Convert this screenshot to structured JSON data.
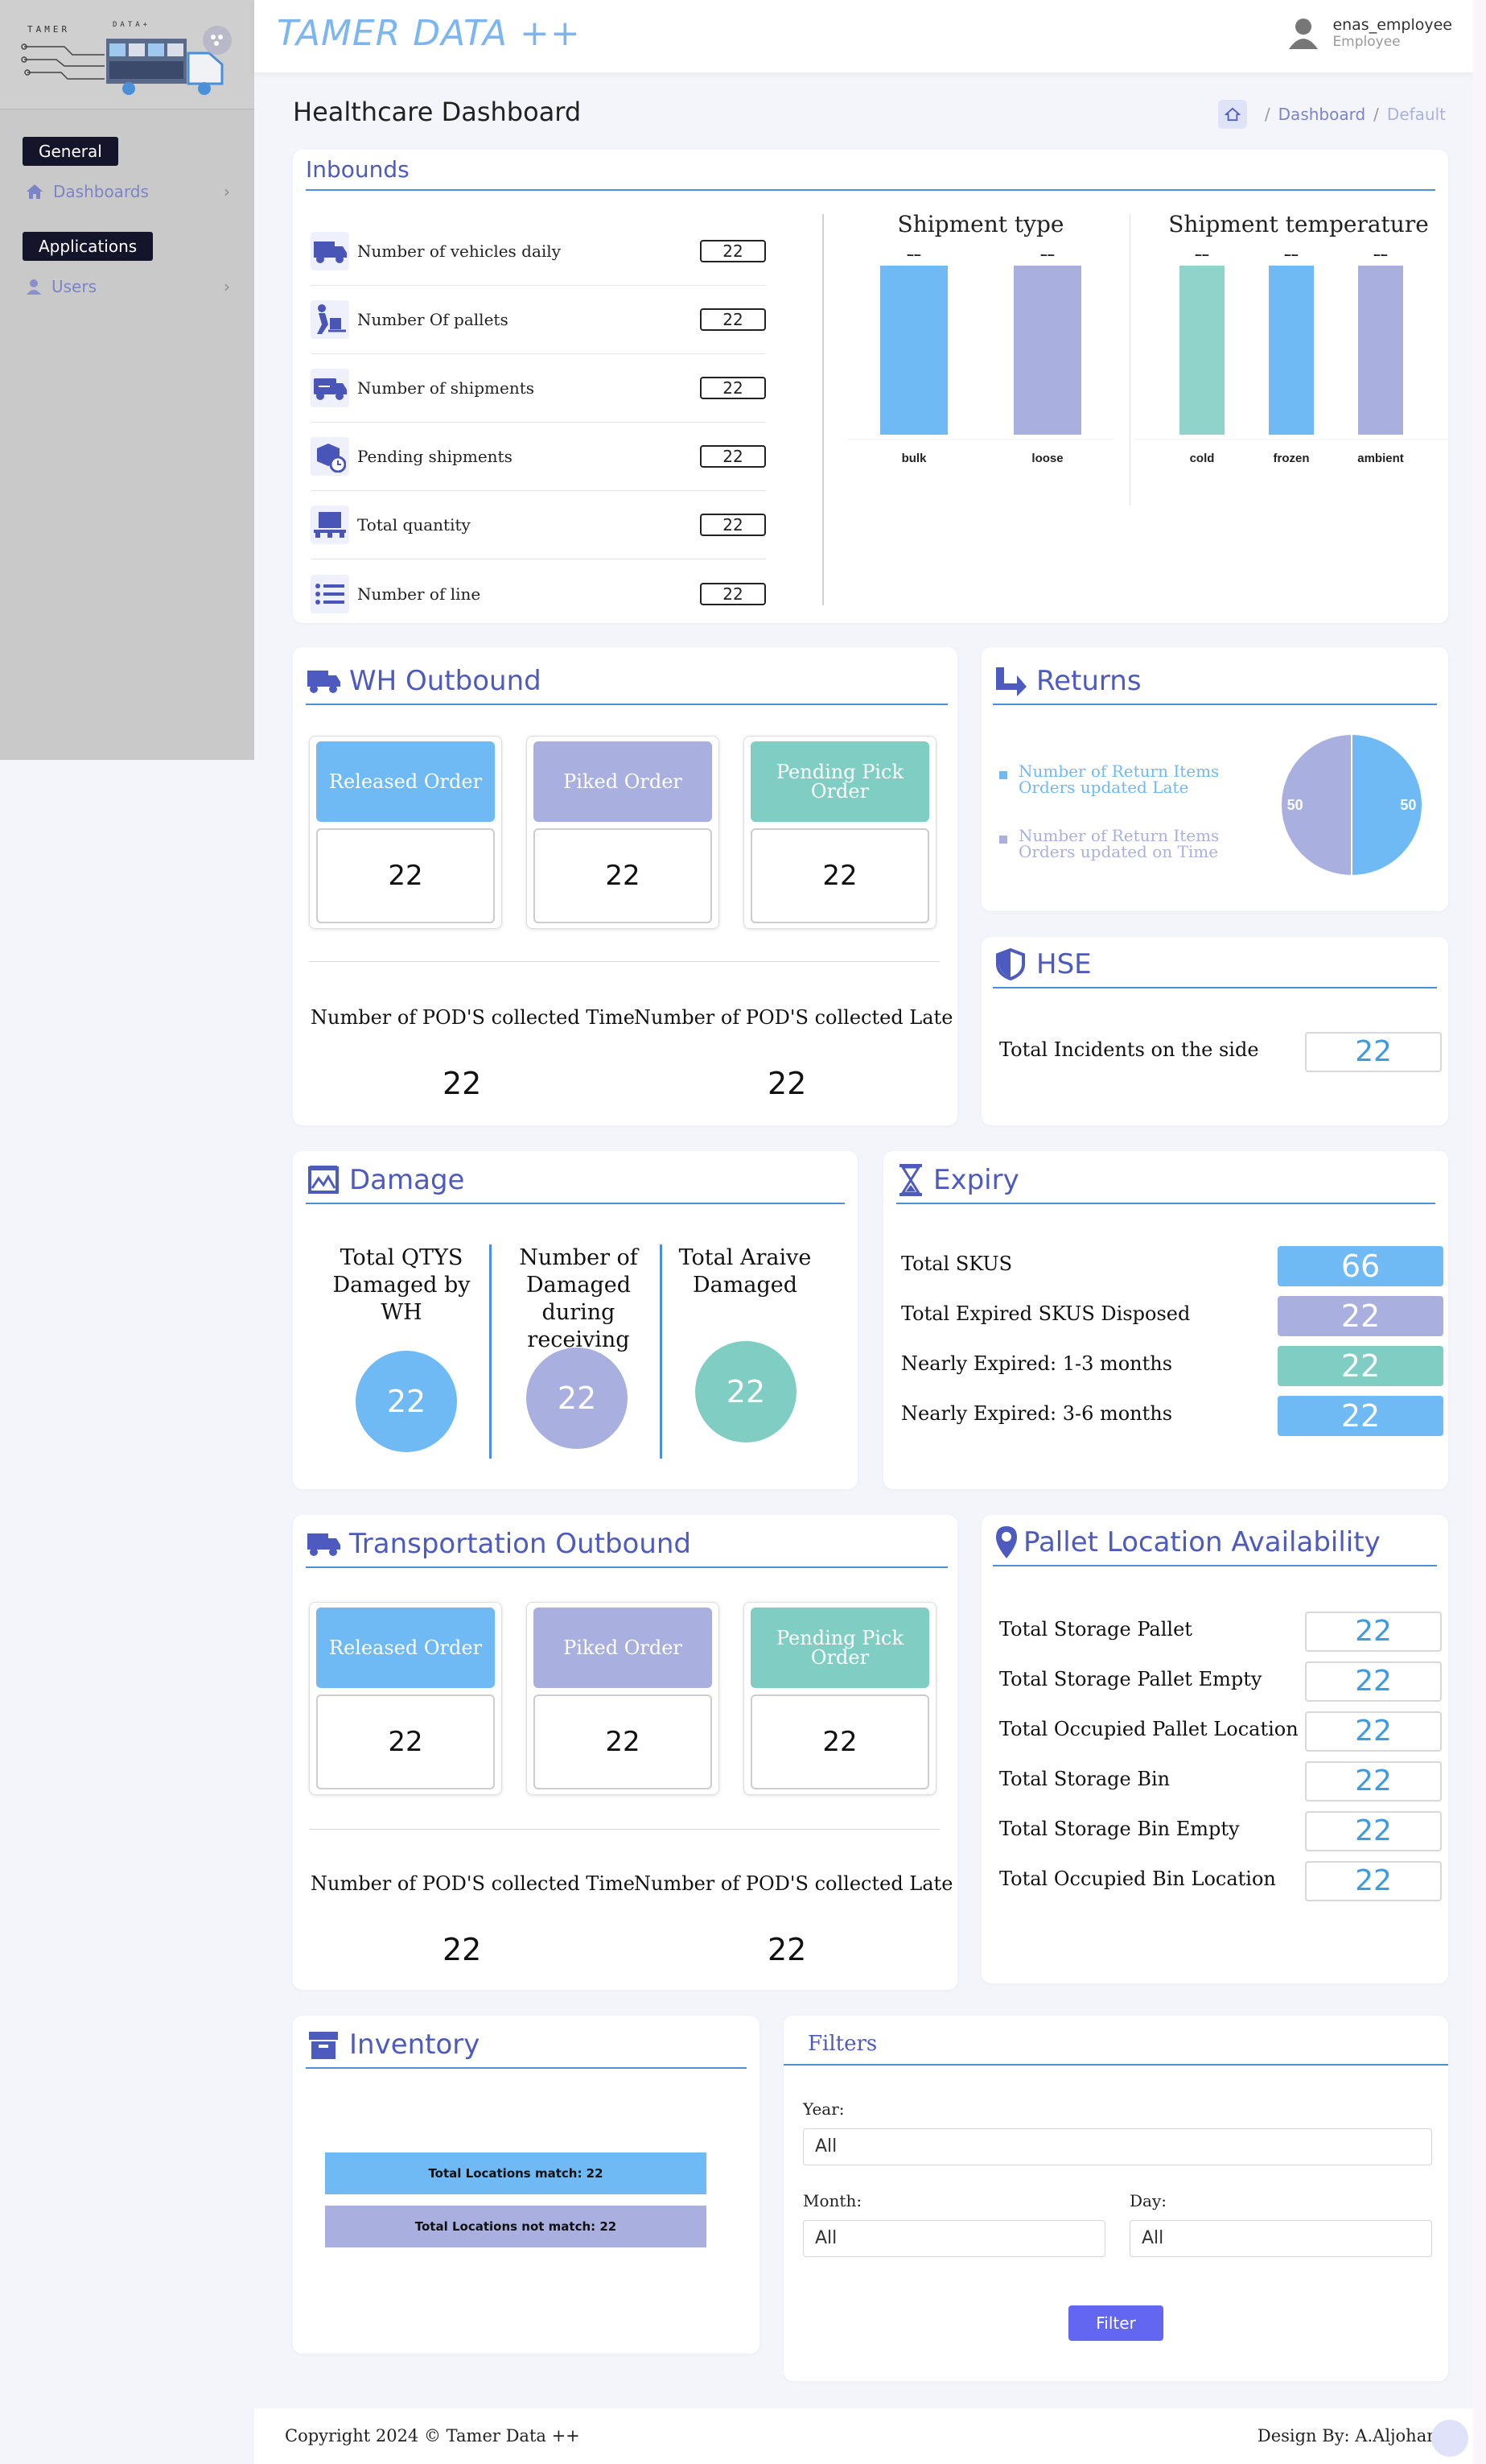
{
  "logo": {
    "text_left": "TAMER",
    "text_right": "DATA+"
  },
  "sidebar": {
    "sections": [
      {
        "title": "General",
        "items": [
          {
            "label": "Dashboards",
            "icon": "home-icon"
          }
        ]
      },
      {
        "title": "Applications",
        "items": [
          {
            "label": "Users",
            "icon": "user-icon"
          }
        ]
      }
    ]
  },
  "header": {
    "brand": "TAMER DATA ++",
    "user_name": "enas_employee",
    "user_role": "Employee"
  },
  "page": {
    "title": "Healthcare Dashboard",
    "breadcrumbs": [
      "Dashboard",
      "Default"
    ]
  },
  "colors": {
    "blue": "#6fb9f5",
    "purple": "#a9b0e0",
    "teal": "#7fcdc3",
    "accent": "#4e5bbe",
    "button": "#6366f1"
  },
  "inbounds": {
    "title": "Inbounds",
    "rows": [
      {
        "label": "Number of vehicles daily",
        "value": "22",
        "icon": "truck-icon"
      },
      {
        "label": "Number Of pallets",
        "value": "22",
        "icon": "dolly-icon"
      },
      {
        "label": "Number of shipments",
        "value": "22",
        "icon": "shipping-truck-icon"
      },
      {
        "label": "Pending shipments",
        "value": "22",
        "icon": "box-clock-icon"
      },
      {
        "label": "Total quantity",
        "value": "22",
        "icon": "pallet-icon"
      },
      {
        "label": "Number of line",
        "value": "22",
        "icon": "list-icon"
      }
    ]
  },
  "chart_data": [
    {
      "type": "bar",
      "title": "Shipment type",
      "categories": [
        "bulk",
        "loose"
      ],
      "values": [
        22,
        22
      ],
      "colors": [
        "#6fb9f5",
        "#a9b0e0"
      ]
    },
    {
      "type": "bar",
      "title": "Shipment temperature",
      "categories": [
        "cold",
        "frozen",
        "ambient"
      ],
      "values": [
        22,
        22,
        22
      ],
      "colors": [
        "#8fd3ca",
        "#6fb9f5",
        "#a9b0e0"
      ]
    },
    {
      "type": "pie",
      "title": "",
      "categories": [
        "Number of Return Items Orders updated Late",
        "Number of Return Items Orders updated on Time"
      ],
      "values": [
        50,
        50
      ],
      "colors": [
        "#6fb9f5",
        "#a9b0e0"
      ],
      "legend": "left"
    }
  ],
  "wh_outbound": {
    "title": "WH Outbound",
    "boxes": [
      {
        "label": "Released Order",
        "value": "22"
      },
      {
        "label": "Piked Order",
        "value": "22"
      },
      {
        "label": "Pending Pick Order",
        "value": "22"
      }
    ],
    "pod_time_label": "Number of POD'S collected Time",
    "pod_time_value": "22",
    "pod_late_label": "Number of POD'S collected Late",
    "pod_late_value": "22"
  },
  "returns": {
    "title": "Returns",
    "legend": [
      "Number of Return Items Orders updated Late",
      "Number of Return Items Orders updated on Time"
    ],
    "values": [
      "50",
      "50"
    ]
  },
  "hse": {
    "title": "HSE",
    "label": "Total Incidents on the side",
    "value": "22"
  },
  "damage": {
    "title": "Damage",
    "items": [
      {
        "label": "Total QTYS Damaged by WH",
        "value": "22"
      },
      {
        "label": "Number of Damaged during receiving",
        "value": "22"
      },
      {
        "label": "Total Araive Damaged",
        "value": "22"
      }
    ]
  },
  "expiry": {
    "title": "Expiry",
    "rows": [
      {
        "label": "Total SKUS",
        "value": "66"
      },
      {
        "label": "Total Expired SKUS Disposed",
        "value": "22"
      },
      {
        "label": "Nearly Expired: 1-3 months",
        "value": "22"
      },
      {
        "label": "Nearly Expired: 3-6 months",
        "value": "22"
      }
    ]
  },
  "transport_outbound": {
    "title": "Transportation Outbound",
    "boxes": [
      {
        "label": "Released Order",
        "value": "22"
      },
      {
        "label": "Piked Order",
        "value": "22"
      },
      {
        "label": "Pending Pick Order",
        "value": "22"
      }
    ],
    "pod_time_label": "Number of POD'S collected Time",
    "pod_time_value": "22",
    "pod_late_label": "Number of POD'S collected Late",
    "pod_late_value": "22"
  },
  "pallet": {
    "title": "Pallet Location Availability",
    "rows": [
      {
        "label": "Total Storage Pallet",
        "value": "22"
      },
      {
        "label": "Total Storage Pallet Empty",
        "value": "22"
      },
      {
        "label": "Total Occupied Pallet Location",
        "value": "22"
      },
      {
        "label": "Total Storage Bin",
        "value": "22"
      },
      {
        "label": "Total Storage Bin Empty",
        "value": "22"
      },
      {
        "label": "Total Occupied Bin Location",
        "value": "22"
      }
    ]
  },
  "inventory": {
    "title": "Inventory",
    "match": "Total Locations match: 22",
    "not_match": "Total Locations not match: 22"
  },
  "filters": {
    "title": "Filters",
    "year_label": "Year:",
    "year_value": "All",
    "month_label": "Month:",
    "month_value": "All",
    "day_label": "Day:",
    "day_value": "All",
    "button": "Filter"
  },
  "footer": {
    "copyright": "Copyright 2024 © Tamer Data ++",
    "design": "Design By: A.Aljohani"
  }
}
